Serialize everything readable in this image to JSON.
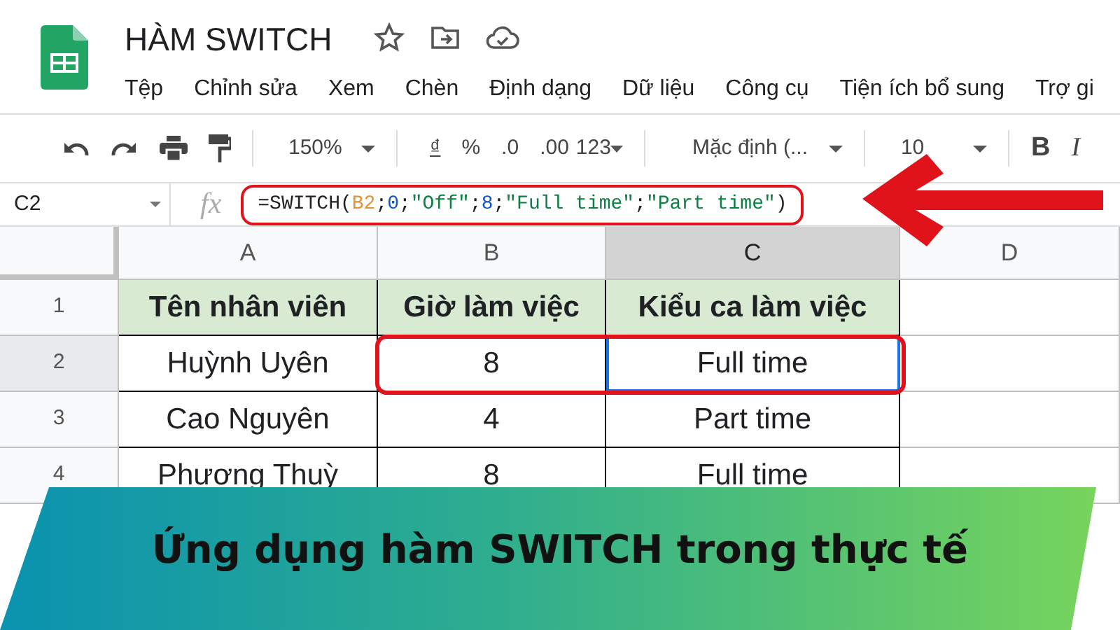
{
  "app": {
    "title": "HÀM SWITCH",
    "menu": [
      "Tệp",
      "Chỉnh sửa",
      "Xem",
      "Chèn",
      "Định dạng",
      "Dữ liệu",
      "Công cụ",
      "Tiện ích bổ sung",
      "Trợ gi"
    ]
  },
  "toolbar": {
    "zoom": "150%",
    "currency": "₫",
    "percent": "%",
    "decrease_decimals": ".0",
    "increase_decimals": ".00",
    "number_format": "123",
    "font": "Mặc định (...",
    "font_size": "10",
    "bold": "B",
    "italic": "I"
  },
  "formula_bar": {
    "cell": "C2",
    "fx": "fx",
    "highlighted": true,
    "arrow": true,
    "formula": [
      {
        "kind": "plain",
        "text": "=SWITCH("
      },
      {
        "kind": "ref",
        "text": "B2"
      },
      {
        "kind": "plain",
        "text": ";"
      },
      {
        "kind": "number",
        "text": "0"
      },
      {
        "kind": "plain",
        "text": ";"
      },
      {
        "kind": "string",
        "text": "\"Off\""
      },
      {
        "kind": "plain",
        "text": ";"
      },
      {
        "kind": "number",
        "text": "8"
      },
      {
        "kind": "plain",
        "text": ";"
      },
      {
        "kind": "string",
        "text": "\"Full time\""
      },
      {
        "kind": "plain",
        "text": ";"
      },
      {
        "kind": "string",
        "text": "\"Part time\""
      },
      {
        "kind": "plain",
        "text": ")"
      }
    ]
  },
  "sheet": {
    "columns": [
      {
        "label": "A",
        "selected": false
      },
      {
        "label": "B",
        "selected": false
      },
      {
        "label": "C",
        "selected": true
      },
      {
        "label": "D",
        "selected": false
      }
    ],
    "rows": [
      {
        "number": "1",
        "selected": false,
        "highlighted": false,
        "cells": [
          {
            "text": "Tên nhân viên",
            "kind": "header",
            "selected": false
          },
          {
            "text": "Giờ làm việc",
            "kind": "header",
            "selected": false
          },
          {
            "text": "Kiểu ca làm việc",
            "kind": "header",
            "selected": false
          }
        ]
      },
      {
        "number": "2",
        "selected": true,
        "highlighted": true,
        "cells": [
          {
            "text": "Huỳnh Uyên",
            "kind": "data",
            "selected": false
          },
          {
            "text": "8",
            "kind": "data",
            "selected": false
          },
          {
            "text": "Full time",
            "kind": "data",
            "selected": true
          }
        ]
      },
      {
        "number": "3",
        "selected": false,
        "highlighted": false,
        "cells": [
          {
            "text": "Cao Nguyên",
            "kind": "data",
            "selected": false
          },
          {
            "text": "4",
            "kind": "data",
            "selected": false
          },
          {
            "text": "Part time",
            "kind": "data",
            "selected": false
          }
        ]
      },
      {
        "number": "4",
        "selected": false,
        "highlighted": false,
        "cells": [
          {
            "text": "Phương Thuỳ",
            "kind": "data",
            "selected": false
          },
          {
            "text": "8",
            "kind": "data",
            "selected": false
          },
          {
            "text": "Full time",
            "kind": "data",
            "selected": false
          }
        ]
      }
    ]
  },
  "banner": {
    "title": "Ứng dụng hàm SWITCH trong thực tế"
  }
}
